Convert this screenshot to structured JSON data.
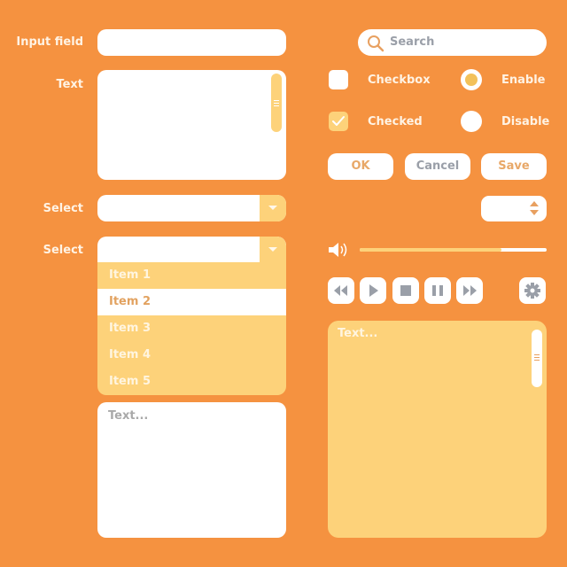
{
  "colors": {
    "background": "#F59240",
    "accent_yellow": "#FDD27A",
    "white": "#FFFFFF",
    "icon_gray": "#9A9FA8",
    "text_orange": "#E2A260"
  },
  "form": {
    "input_label": "Input field",
    "input_value": "",
    "text_label": "Text",
    "text_value": "",
    "select1_label": "Select",
    "select1_value": "",
    "select2_label": "Select",
    "select2_value": "",
    "dropdown_items": [
      "Item 1",
      "Item 2",
      "Item 3",
      "Item 4",
      "Item 5"
    ],
    "dropdown_selected_index": 1,
    "textarea2_placeholder": "Text..."
  },
  "search": {
    "placeholder": "Search",
    "icon": "search-icon"
  },
  "checkboxes": [
    {
      "label": "Checkbox",
      "checked": false
    },
    {
      "label": "Checked",
      "checked": true
    }
  ],
  "radios": [
    {
      "label": "Enable",
      "selected": true
    },
    {
      "label": "Disable",
      "selected": false
    }
  ],
  "buttons": {
    "ok": "OK",
    "cancel": "Cancel",
    "save": "Save"
  },
  "stepper": {
    "value": "",
    "icon": "up-down-arrows-icon"
  },
  "volume": {
    "icon": "speaker-icon",
    "level_percent": 76
  },
  "media_controls": [
    "rewind",
    "play",
    "stop",
    "pause",
    "fast-forward"
  ],
  "settings": {
    "icon": "gear-icon"
  },
  "textarea3_placeholder": "Text..."
}
